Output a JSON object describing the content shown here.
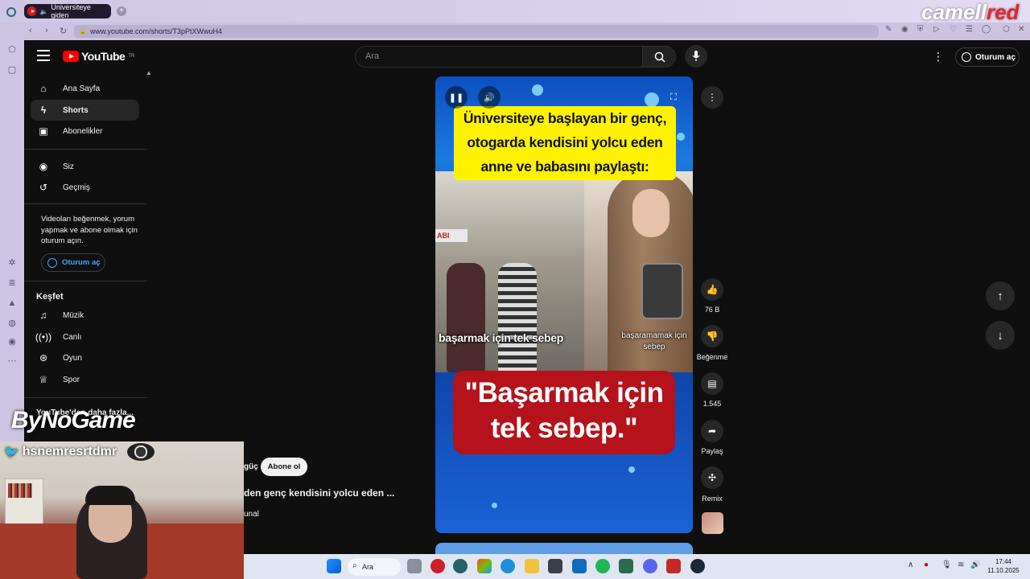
{
  "browser": {
    "tab_title": "Üniversiteye giden",
    "url": "www.youtube.com/shorts/T3pPtXWwuH4",
    "brand_overlay_white": "camell",
    "brand_overlay_red": "red"
  },
  "header": {
    "logo_text": "YouTube",
    "logo_sup": "TR",
    "search_placeholder": "Ara",
    "signin_label": "Oturum aç"
  },
  "sidebar": {
    "items": [
      {
        "label": "Ana Sayfa",
        "icon": "home-icon"
      },
      {
        "label": "Shorts",
        "icon": "shorts-icon"
      },
      {
        "label": "Abonelikler",
        "icon": "subscriptions-icon"
      }
    ],
    "you_items": [
      {
        "label": "Siz",
        "icon": "user-icon"
      },
      {
        "label": "Geçmiş",
        "icon": "history-icon"
      }
    ],
    "signin_note": "Videoları beğenmek, yorum yapmak ve abone olmak için oturum açın.",
    "signin_button": "Oturum aç",
    "explore_title": "Keşfet",
    "explore_items": [
      {
        "label": "Müzik",
        "icon": "music-icon"
      },
      {
        "label": "Canlı",
        "icon": "live-icon"
      },
      {
        "label": "Oyun",
        "icon": "gaming-icon"
      },
      {
        "label": "Spor",
        "icon": "trophy-icon"
      }
    ],
    "more_title": "YouTube'dan daha fazla..."
  },
  "overlay": {
    "sponsor": "ByNoGame",
    "handle": "hsnemresrtdmr"
  },
  "short": {
    "channel_fragment": "güç",
    "subscribe_label": "Abone ol",
    "title_fragment": "den genç kendisini yolcu eden ...",
    "sound_fragment": "unal",
    "caption_top": "Üniversiteye başlayan bir genç, otogarda kendisini yolcu eden anne ve babasını paylaştı:",
    "label_left": "başarmak için tek sebep",
    "label_right": "başaramamak için sebep",
    "quote": "\"Başarmak için tek sebep.\"",
    "sign_text": "ABI"
  },
  "actions": {
    "likes": "76 B",
    "dislike": "Beğenme",
    "comments": "1.545",
    "share": "Paylaş",
    "remix": "Remix"
  },
  "taskbar": {
    "search_label": "Ara",
    "time": "17:44",
    "date": "11.10.2025"
  },
  "colors": {
    "background": "#0f0f0f",
    "youtube_red": "#ff0000",
    "caption_yellow": "#fff200",
    "quote_red": "#b5121b",
    "link_blue": "#3ea6ff"
  }
}
